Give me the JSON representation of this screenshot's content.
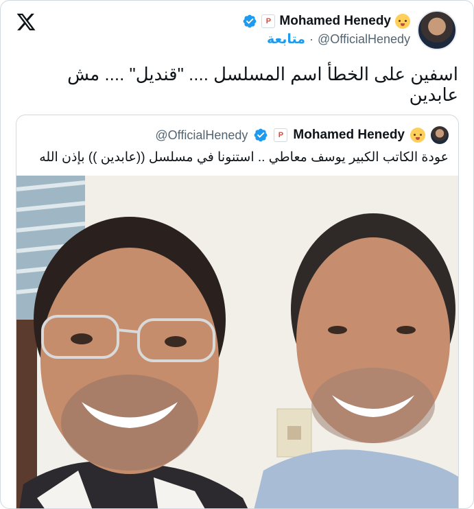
{
  "brand": {
    "logo_icon": "x-logo-icon"
  },
  "author": {
    "display_name": "Mohamed Henedy",
    "handle": "@OfficialHenedy",
    "separator": "·",
    "follow_label": "متابعة",
    "badge_letter": "P",
    "verified_color": "#1d9bf0"
  },
  "tweet": {
    "text": "اسفين على الخطأ اسم المسلسل .... \"قنديل\" .... مش عابدين"
  },
  "quoted": {
    "display_name": "Mohamed Henedy",
    "handle": "@OfficialHenedy",
    "badge_letter": "P",
    "text": "عودة الكاتب الكبير يوسف معاطي .. استنونا في مسلسل ((عابدين )) بإذن الله",
    "media_description_icon": "selfie-photo"
  },
  "colors": {
    "accent": "#1d9bf0",
    "secondary_text": "#536471",
    "border": "#cfd9de"
  }
}
